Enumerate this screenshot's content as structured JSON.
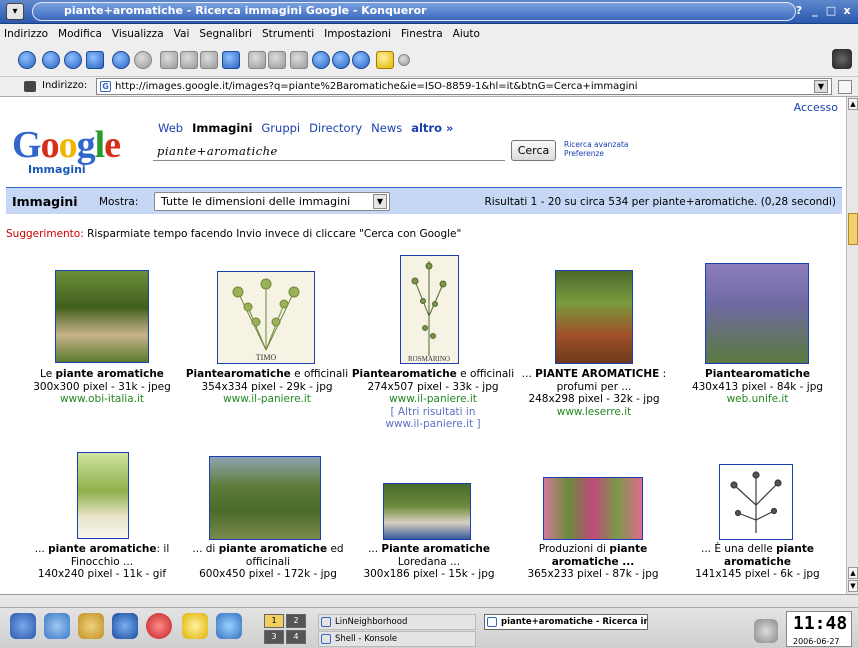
{
  "window": {
    "title": "piante+aromatiche - Ricerca immagini Google - Konqueror",
    "buttons": [
      "?",
      "_",
      "□",
      "x"
    ]
  },
  "menubar": [
    "Indirizzo",
    "Modifica",
    "Visualizza",
    "Vai",
    "Segnalibri",
    "Strumenti",
    "Impostazioni",
    "Finestra",
    "Aiuto"
  ],
  "location": {
    "label": "Indirizzo:",
    "url": "http://images.google.it/images?q=piante%2Baromatiche&ie=ISO-8859-1&hl=it&btnG=Cerca+immagini"
  },
  "google": {
    "logo": "Google",
    "logo_sub": "Immagini",
    "access": "Accesso",
    "nav": [
      "Web",
      "Immagini",
      "Gruppi",
      "Directory",
      "News",
      "altro »"
    ],
    "query": "piante+aromatiche",
    "search_button": "Cerca",
    "advanced": "Ricerca avanzata",
    "prefs": "Preferenze"
  },
  "infobar": {
    "title": "Immagini",
    "show_label": "Mostra:",
    "size_select": "Tutte le dimensioni delle immagini",
    "results": "Risultati 1 - 20 su circa 534 per piante+aromatiche. (0,28 secondi)"
  },
  "suggestion": {
    "label": "Suggerimento:",
    "text": " Risparmiate tempo facendo Invio invece di cliccare \"Cerca con Google\""
  },
  "results": [
    {
      "l1_pre": "Le ",
      "l1_bold": "piante aromatiche",
      "l1_post": "",
      "l2": "",
      "dims": "300x300 pixel - 31k - jpeg",
      "site": "www.obi-italia.it",
      "more": ""
    },
    {
      "l1_pre": "",
      "l1_bold": "Piantearomatiche",
      "l1_post": " e officinali",
      "l2": "",
      "dims": "354x334 pixel - 29k - jpg",
      "site": "www.il-paniere.it",
      "more": ""
    },
    {
      "l1_pre": "",
      "l1_bold": "Piantearomatiche",
      "l1_post": " e officinali",
      "l2": "",
      "dims": "274x507 pixel - 33k - jpg",
      "site": "www.il-paniere.it",
      "more": "[ Altri risultati in www.il-paniere.it ]"
    },
    {
      "l1_pre": "... ",
      "l1_bold": "PIANTE AROMATICHE",
      "l1_post": " :",
      "l2": "profumi per ...",
      "dims": "248x298 pixel - 32k - jpg",
      "site": "www.leserre.it",
      "more": ""
    },
    {
      "l1_pre": "",
      "l1_bold": "Piantearomatiche",
      "l1_post": "",
      "l2": "",
      "dims": "430x413 pixel - 84k - jpg",
      "site": "web.unife.it",
      "more": ""
    },
    {
      "l1_pre": "... ",
      "l1_bold": "piante aromatiche",
      "l1_post": ": il",
      "l2": "Finocchio ...",
      "dims": "140x240 pixel - 11k - gif",
      "site": "",
      "more": ""
    },
    {
      "l1_pre": "... di ",
      "l1_bold": "piante aromatiche",
      "l1_post": " ed",
      "l2": "officinali",
      "dims": "600x450 pixel - 172k - jpg",
      "site": "",
      "more": ""
    },
    {
      "l1_pre": "... ",
      "l1_bold": "Piante aromatiche",
      "l1_post": "",
      "l2": "Loredana ...",
      "dims": "300x186 pixel - 15k - jpg",
      "site": "",
      "more": ""
    },
    {
      "l1_pre": "Produzioni di ",
      "l1_bold": "piante",
      "l1_post": "",
      "l2": "aromatiche ...",
      "dims": "365x233 pixel - 87k - jpg",
      "site": "",
      "more": ""
    },
    {
      "l1_pre": "... È una delle ",
      "l1_bold": "piante",
      "l1_post": "",
      "l2": "aromatiche",
      "dims": "141x145 pixel - 6k - jpg",
      "site": "",
      "more": ""
    }
  ],
  "thumb_captions": {
    "timo": "TIMO",
    "rosmarino": "ROSMARINO"
  },
  "taskbar": {
    "pager": [
      "1",
      "2",
      "3",
      "4"
    ],
    "tasks": [
      "LinNeighborhood",
      "Shell - Konsole",
      "piante+aromatiche - Ricerca imma"
    ],
    "time": "11:48",
    "date": "2006-06-27"
  }
}
